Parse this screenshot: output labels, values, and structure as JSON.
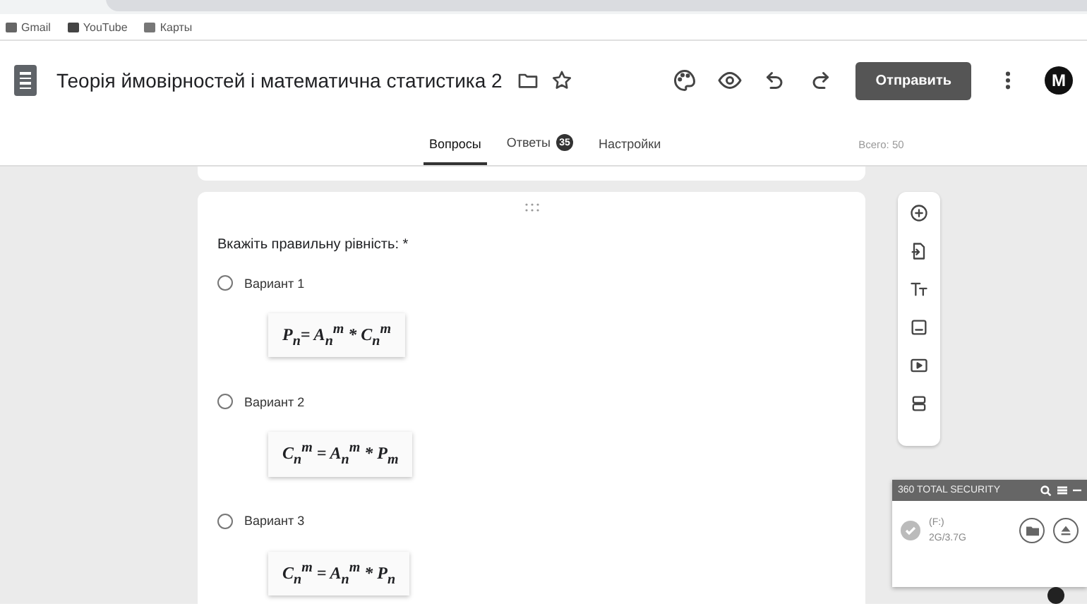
{
  "bookmarks": [
    {
      "label": "Gmail"
    },
    {
      "label": "YouTube"
    },
    {
      "label": "Карты"
    }
  ],
  "header": {
    "title": "Теорія ймовірностей і математична статистика 2",
    "send_button": "Отправить",
    "avatar": "M"
  },
  "tabs": [
    {
      "label": "Вопросы",
      "selected": true
    },
    {
      "label": "Ответы",
      "selected": false,
      "badge": "35"
    },
    {
      "label": "Настройки",
      "selected": false
    }
  ],
  "total": "Всего: 50",
  "question": {
    "title": "Вкажіть правильну рівність:",
    "required_mark": "*",
    "options": [
      {
        "label": "Вариант 1",
        "selected": false,
        "formula": "P$_{n}$= A$_{n}$$^{m}$ * C$_{n}$$^{m}$"
      },
      {
        "label": "Вариант 2",
        "selected": false,
        "formula": "C$_{n}$$^{m}$ = A$_{n}$$^{m}$ * P$_{m}$"
      },
      {
        "label": "Вариант 3",
        "selected": false,
        "formula": "C$_{n}$$^{m}$ = A$_{n}$$^{m}$ * P$_{n}$"
      }
    ]
  },
  "popup": {
    "title": "360 TOTAL SECURITY",
    "drive": "(F:)",
    "usage": "2G/3.7G"
  }
}
